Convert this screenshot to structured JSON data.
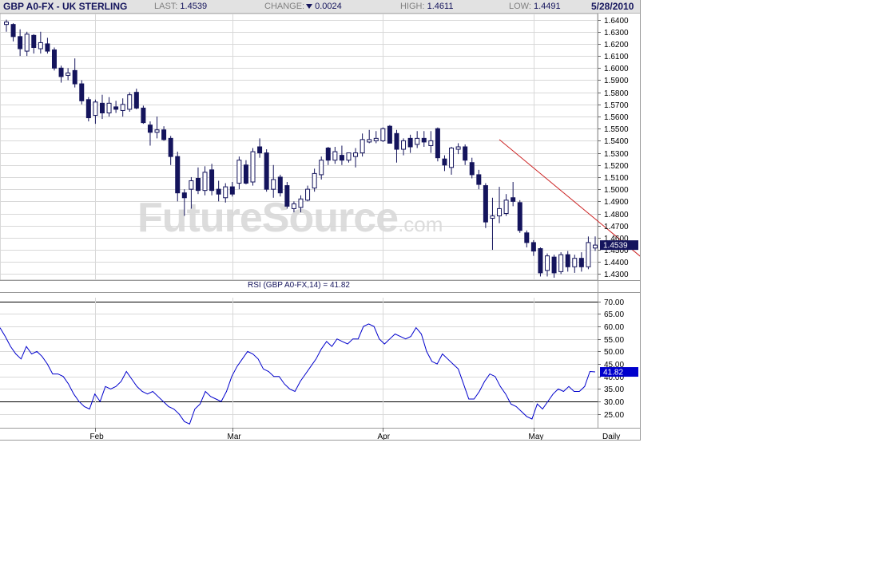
{
  "header": {
    "title": "GBP A0-FX - UK STERLING",
    "last_label": "LAST:",
    "last_value": "1.4539",
    "change_label": "CHANGE:",
    "change_value": "0.0024",
    "high_label": "HIGH:",
    "high_value": "1.4611",
    "low_label": "LOW:",
    "low_value": "1.4491",
    "date": "5/28/2010"
  },
  "watermark": {
    "main": "FutureSource",
    "suffix": ".com"
  },
  "colors": {
    "candle": "#14145c",
    "rsi_line": "#0000cc",
    "trend_line": "#cc2222",
    "price_box": "#14145c",
    "grid": "#d8d8d8"
  },
  "chart_data": [
    {
      "type": "candlestick",
      "ylim": [
        1.425,
        1.645
      ],
      "y_ticks": [
        "1.6400",
        "1.6300",
        "1.6200",
        "1.6100",
        "1.6000",
        "1.5900",
        "1.5800",
        "1.5700",
        "1.5600",
        "1.5500",
        "1.5400",
        "1.5300",
        "1.5200",
        "1.5100",
        "1.5000",
        "1.4900",
        "1.4800",
        "1.4700",
        "1.4600",
        "1.4500",
        "1.4400",
        "1.4300"
      ],
      "x_labels": [
        "Feb",
        "Mar",
        "Apr",
        "May",
        "Daily"
      ],
      "x_label_index": [
        13,
        33,
        55,
        77
      ],
      "grid": true,
      "last_price_label": "1.4539",
      "last_price": 1.4539,
      "trend_line": [
        {
          "i": 72,
          "v": 1.541
        },
        {
          "i": 97,
          "v": 1.424
        }
      ],
      "candles": [
        {
          "o": 1.636,
          "h": 1.64,
          "l": 1.63,
          "c": 1.638
        },
        {
          "o": 1.636,
          "h": 1.637,
          "l": 1.622,
          "c": 1.626
        },
        {
          "o": 1.626,
          "h": 1.632,
          "l": 1.61,
          "c": 1.616
        },
        {
          "o": 1.614,
          "h": 1.63,
          "l": 1.61,
          "c": 1.628
        },
        {
          "o": 1.627,
          "h": 1.628,
          "l": 1.612,
          "c": 1.617
        },
        {
          "o": 1.616,
          "h": 1.63,
          "l": 1.612,
          "c": 1.621
        },
        {
          "o": 1.62,
          "h": 1.625,
          "l": 1.612,
          "c": 1.614
        },
        {
          "o": 1.615,
          "h": 1.617,
          "l": 1.598,
          "c": 1.6
        },
        {
          "o": 1.6,
          "h": 1.602,
          "l": 1.588,
          "c": 1.593
        },
        {
          "o": 1.594,
          "h": 1.6,
          "l": 1.59,
          "c": 1.596
        },
        {
          "o": 1.598,
          "h": 1.608,
          "l": 1.584,
          "c": 1.587
        },
        {
          "o": 1.587,
          "h": 1.59,
          "l": 1.57,
          "c": 1.573
        },
        {
          "o": 1.574,
          "h": 1.576,
          "l": 1.556,
          "c": 1.559
        },
        {
          "o": 1.561,
          "h": 1.574,
          "l": 1.554,
          "c": 1.572
        },
        {
          "o": 1.571,
          "h": 1.578,
          "l": 1.558,
          "c": 1.563
        },
        {
          "o": 1.563,
          "h": 1.576,
          "l": 1.56,
          "c": 1.571
        },
        {
          "o": 1.568,
          "h": 1.573,
          "l": 1.563,
          "c": 1.566
        },
        {
          "o": 1.565,
          "h": 1.575,
          "l": 1.56,
          "c": 1.57
        },
        {
          "o": 1.566,
          "h": 1.58,
          "l": 1.564,
          "c": 1.578
        },
        {
          "o": 1.58,
          "h": 1.583,
          "l": 1.566,
          "c": 1.567
        },
        {
          "o": 1.567,
          "h": 1.569,
          "l": 1.554,
          "c": 1.555
        },
        {
          "o": 1.553,
          "h": 1.556,
          "l": 1.536,
          "c": 1.547
        },
        {
          "o": 1.547,
          "h": 1.56,
          "l": 1.542,
          "c": 1.549
        },
        {
          "o": 1.549,
          "h": 1.552,
          "l": 1.54,
          "c": 1.541
        },
        {
          "o": 1.542,
          "h": 1.544,
          "l": 1.52,
          "c": 1.527
        },
        {
          "o": 1.527,
          "h": 1.531,
          "l": 1.49,
          "c": 1.497
        },
        {
          "o": 1.497,
          "h": 1.5,
          "l": 1.478,
          "c": 1.493
        },
        {
          "o": 1.5,
          "h": 1.51,
          "l": 1.484,
          "c": 1.507
        },
        {
          "o": 1.509,
          "h": 1.518,
          "l": 1.496,
          "c": 1.499
        },
        {
          "o": 1.499,
          "h": 1.519,
          "l": 1.495,
          "c": 1.514
        },
        {
          "o": 1.516,
          "h": 1.521,
          "l": 1.495,
          "c": 1.499
        },
        {
          "o": 1.5,
          "h": 1.507,
          "l": 1.49,
          "c": 1.496
        },
        {
          "o": 1.493,
          "h": 1.505,
          "l": 1.489,
          "c": 1.502
        },
        {
          "o": 1.502,
          "h": 1.506,
          "l": 1.494,
          "c": 1.496
        },
        {
          "o": 1.505,
          "h": 1.527,
          "l": 1.5,
          "c": 1.524
        },
        {
          "o": 1.52,
          "h": 1.524,
          "l": 1.504,
          "c": 1.505
        },
        {
          "o": 1.506,
          "h": 1.534,
          "l": 1.503,
          "c": 1.531
        },
        {
          "o": 1.535,
          "h": 1.542,
          "l": 1.526,
          "c": 1.53
        },
        {
          "o": 1.53,
          "h": 1.533,
          "l": 1.498,
          "c": 1.5
        },
        {
          "o": 1.5,
          "h": 1.52,
          "l": 1.493,
          "c": 1.508
        },
        {
          "o": 1.51,
          "h": 1.512,
          "l": 1.494,
          "c": 1.497
        },
        {
          "o": 1.503,
          "h": 1.506,
          "l": 1.484,
          "c": 1.486
        },
        {
          "o": 1.484,
          "h": 1.49,
          "l": 1.481,
          "c": 1.488
        },
        {
          "o": 1.485,
          "h": 1.495,
          "l": 1.481,
          "c": 1.492
        },
        {
          "o": 1.491,
          "h": 1.503,
          "l": 1.49,
          "c": 1.5
        },
        {
          "o": 1.501,
          "h": 1.517,
          "l": 1.498,
          "c": 1.513
        },
        {
          "o": 1.512,
          "h": 1.527,
          "l": 1.508,
          "c": 1.524
        },
        {
          "o": 1.534,
          "h": 1.535,
          "l": 1.52,
          "c": 1.524
        },
        {
          "o": 1.524,
          "h": 1.535,
          "l": 1.521,
          "c": 1.531
        },
        {
          "o": 1.528,
          "h": 1.536,
          "l": 1.52,
          "c": 1.524
        },
        {
          "o": 1.524,
          "h": 1.53,
          "l": 1.522,
          "c": 1.53
        },
        {
          "o": 1.527,
          "h": 1.534,
          "l": 1.518,
          "c": 1.53
        },
        {
          "o": 1.53,
          "h": 1.546,
          "l": 1.527,
          "c": 1.541
        },
        {
          "o": 1.539,
          "h": 1.549,
          "l": 1.538,
          "c": 1.541
        },
        {
          "o": 1.54,
          "h": 1.548,
          "l": 1.538,
          "c": 1.542
        },
        {
          "o": 1.54,
          "h": 1.551,
          "l": 1.539,
          "c": 1.55
        },
        {
          "o": 1.552,
          "h": 1.553,
          "l": 1.538,
          "c": 1.538
        },
        {
          "o": 1.546,
          "h": 1.549,
          "l": 1.522,
          "c": 1.533
        },
        {
          "o": 1.533,
          "h": 1.542,
          "l": 1.528,
          "c": 1.54
        },
        {
          "o": 1.542,
          "h": 1.545,
          "l": 1.53,
          "c": 1.535
        },
        {
          "o": 1.537,
          "h": 1.548,
          "l": 1.534,
          "c": 1.542
        },
        {
          "o": 1.542,
          "h": 1.548,
          "l": 1.535,
          "c": 1.539
        },
        {
          "o": 1.536,
          "h": 1.548,
          "l": 1.53,
          "c": 1.54
        },
        {
          "o": 1.55,
          "h": 1.551,
          "l": 1.523,
          "c": 1.526
        },
        {
          "o": 1.525,
          "h": 1.528,
          "l": 1.515,
          "c": 1.52
        },
        {
          "o": 1.518,
          "h": 1.535,
          "l": 1.512,
          "c": 1.534
        },
        {
          "o": 1.533,
          "h": 1.538,
          "l": 1.529,
          "c": 1.535
        },
        {
          "o": 1.535,
          "h": 1.537,
          "l": 1.52,
          "c": 1.524
        },
        {
          "o": 1.522,
          "h": 1.526,
          "l": 1.509,
          "c": 1.512
        },
        {
          "o": 1.512,
          "h": 1.516,
          "l": 1.5,
          "c": 1.504
        },
        {
          "o": 1.503,
          "h": 1.505,
          "l": 1.468,
          "c": 1.473
        },
        {
          "o": 1.476,
          "h": 1.493,
          "l": 1.45,
          "c": 1.478
        },
        {
          "o": 1.478,
          "h": 1.502,
          "l": 1.472,
          "c": 1.484
        },
        {
          "o": 1.48,
          "h": 1.496,
          "l": 1.478,
          "c": 1.491
        },
        {
          "o": 1.493,
          "h": 1.506,
          "l": 1.486,
          "c": 1.49
        },
        {
          "o": 1.489,
          "h": 1.491,
          "l": 1.464,
          "c": 1.466
        },
        {
          "o": 1.464,
          "h": 1.466,
          "l": 1.452,
          "c": 1.456
        },
        {
          "o": 1.456,
          "h": 1.458,
          "l": 1.445,
          "c": 1.449
        },
        {
          "o": 1.451,
          "h": 1.452,
          "l": 1.428,
          "c": 1.431
        },
        {
          "o": 1.433,
          "h": 1.447,
          "l": 1.428,
          "c": 1.445
        },
        {
          "o": 1.444,
          "h": 1.446,
          "l": 1.427,
          "c": 1.431
        },
        {
          "o": 1.432,
          "h": 1.448,
          "l": 1.43,
          "c": 1.446
        },
        {
          "o": 1.446,
          "h": 1.449,
          "l": 1.432,
          "c": 1.436
        },
        {
          "o": 1.436,
          "h": 1.446,
          "l": 1.431,
          "c": 1.443
        },
        {
          "o": 1.443,
          "h": 1.448,
          "l": 1.432,
          "c": 1.436
        },
        {
          "o": 1.436,
          "h": 1.461,
          "l": 1.434,
          "c": 1.456
        },
        {
          "o": 1.4515,
          "h": 1.4611,
          "l": 1.4491,
          "c": 1.4539
        }
      ]
    },
    {
      "type": "line",
      "title": "RSI (GBP A0-FX,14) = 41.82",
      "ylim": [
        19.5,
        71.5
      ],
      "y_ticks": [
        "70.00",
        "65.00",
        "60.00",
        "55.00",
        "50.00",
        "45.00",
        "40.00",
        "35.00",
        "30.00",
        "25.00"
      ],
      "reference_lines": [
        70,
        30
      ],
      "last_value_label": "41.82",
      "last_value": 41.82,
      "series": [
        {
          "values": [
            59.5,
            56,
            52,
            49,
            47,
            52,
            49,
            50,
            48,
            45,
            41,
            41,
            40,
            37,
            33,
            30,
            28,
            27,
            33,
            30,
            36,
            35,
            36,
            38,
            42,
            39,
            36,
            34,
            33,
            34,
            32,
            30,
            28,
            27,
            25,
            22,
            21,
            27,
            29,
            34,
            32,
            31,
            30,
            34,
            40,
            44,
            47,
            50,
            49,
            47,
            43,
            42,
            40,
            40,
            37,
            35,
            34,
            38,
            41,
            44,
            47,
            51,
            54,
            52,
            55,
            54,
            53,
            55,
            55,
            60,
            61,
            60,
            55,
            53,
            55,
            57,
            56,
            55,
            56,
            59.5,
            57,
            50,
            46,
            45,
            49,
            47,
            45,
            43,
            37,
            31,
            31,
            34,
            38,
            41,
            40,
            36,
            33,
            29,
            28,
            26,
            24,
            23,
            29,
            27,
            30,
            33,
            35,
            34,
            36,
            34,
            34,
            36,
            42,
            41.82
          ]
        }
      ]
    }
  ]
}
